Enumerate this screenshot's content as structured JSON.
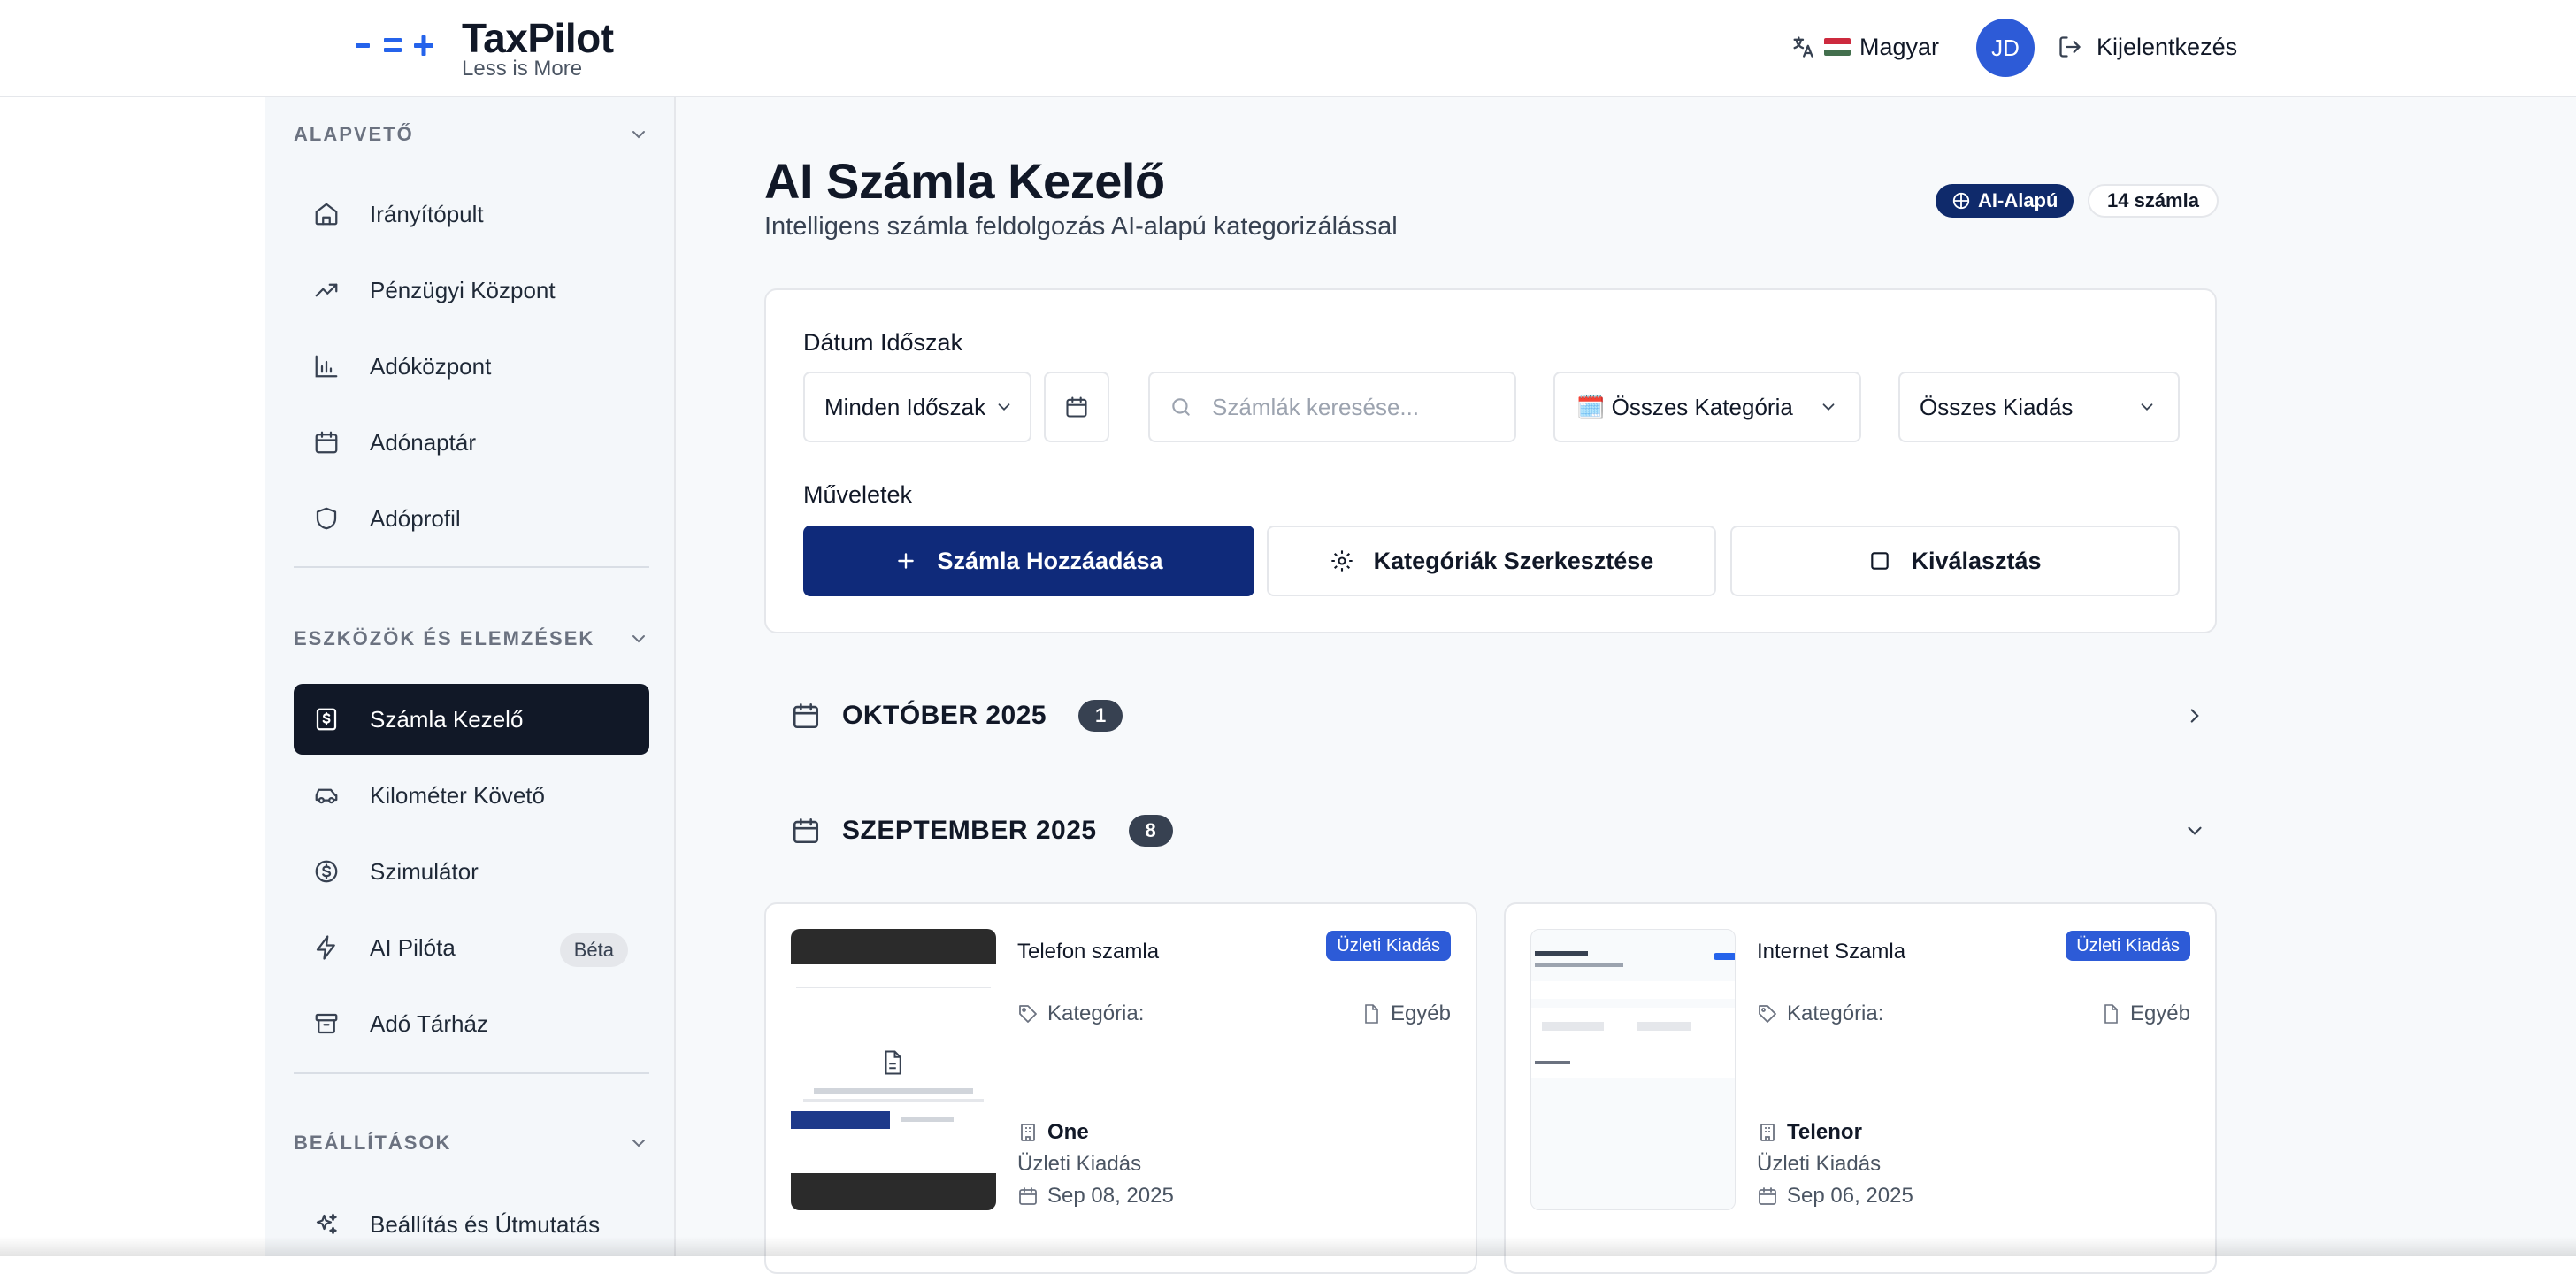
{
  "app": {
    "name": "TaxPilot",
    "tagline": "Less is More"
  },
  "header": {
    "language": "Magyar",
    "avatar_initials": "JD",
    "logout_label": "Kijelentkezés"
  },
  "sidebar": {
    "sections": [
      {
        "title": "ALAPVETŐ",
        "items": [
          {
            "label": "Irányítópult",
            "icon": "home-icon"
          },
          {
            "label": "Pénzügyi Központ",
            "icon": "trending-up-icon"
          },
          {
            "label": "Adóközpont",
            "icon": "bar-chart-icon"
          },
          {
            "label": "Adónaptár",
            "icon": "calendar-icon"
          },
          {
            "label": "Adóprofil",
            "icon": "shield-icon"
          }
        ]
      },
      {
        "title": "ESZKÖZÖK ÉS ELEMZÉSEK",
        "items": [
          {
            "label": "Számla Kezelő",
            "icon": "receipt-icon",
            "active": true
          },
          {
            "label": "Kilométer Követő",
            "icon": "car-icon"
          },
          {
            "label": "Szimulátor",
            "icon": "dollar-circle-icon"
          },
          {
            "label": "AI Pilóta",
            "icon": "zap-icon",
            "badge": "Béta"
          },
          {
            "label": "Adó Tárház",
            "icon": "archive-icon"
          }
        ]
      },
      {
        "title": "BEÁLLÍTÁSOK",
        "items": [
          {
            "label": "Beállítás és Útmutatás",
            "icon": "sparkles-icon"
          }
        ]
      }
    ]
  },
  "page": {
    "title": "AI Számla Kezelő",
    "subtitle": "Intelligens számla feldolgozás AI-alapú kategorizálással",
    "ai_badge": "AI-Alapú",
    "count_badge": "14 számla"
  },
  "filters": {
    "date_label": "Dátum Időszak",
    "period_value": "Minden Időszak",
    "search_placeholder": "Számlák keresése...",
    "category_value": "🗓️ Összes Kategória",
    "expense_value": "Összes Kiadás",
    "actions_label": "Műveletek",
    "add_button": "Számla Hozzáadása",
    "edit_categories_button": "Kategóriák Szerkesztése",
    "select_button": "Kiválasztás"
  },
  "months": [
    {
      "title": "OKTÓBER 2025",
      "count": "1",
      "expanded": false
    },
    {
      "title": "SZEPTEMBER 2025",
      "count": "8",
      "expanded": true
    }
  ],
  "invoices": [
    {
      "name": "Telefon szamla",
      "type_badge": "Üzleti Kiadás",
      "category_label": "Kategória:",
      "category_value": "Egyéb",
      "vendor": "One",
      "expense_type": "Üzleti Kiadás",
      "date": "Sep 08, 2025"
    },
    {
      "name": "Internet Szamla",
      "type_badge": "Üzleti Kiadás",
      "category_label": "Kategória:",
      "category_value": "Egyéb",
      "vendor": "Telenor",
      "expense_type": "Üzleti Kiadás",
      "date": "Sep 06, 2025"
    }
  ],
  "colors": {
    "primary": "#0f2a7a",
    "accent": "#2d5bd7",
    "sidebar_active": "#111827"
  }
}
